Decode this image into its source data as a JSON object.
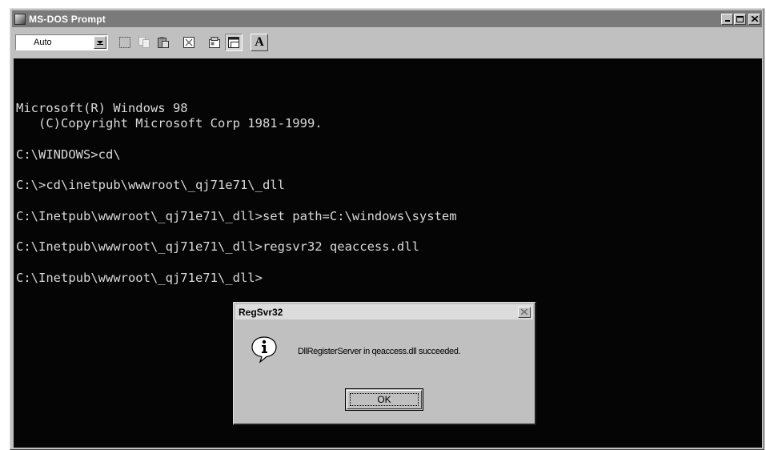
{
  "window": {
    "title": "MS-DOS Prompt",
    "icon": "msdos-app-icon",
    "controls": [
      "minimize-icon",
      "maximize-icon",
      "close-icon"
    ]
  },
  "toolbar": {
    "font_size_value": "Auto",
    "buttons": [
      "mark-icon",
      "copy-icon",
      "paste-icon",
      "fullscreen-icon",
      "properties-icon",
      "background-icon",
      "font-icon"
    ],
    "font_button_label": "A"
  },
  "console": {
    "lines": [
      "Microsoft(R) Windows 98",
      "   (C)Copyright Microsoft Corp 1981-1999.",
      "C:\\WINDOWS>cd\\",
      "C:\\>cd\\inetpub\\wwwroot\\_qj71e71\\_dll",
      "C:\\Inetpub\\wwwroot\\_qj71e71\\_dll>set path=C:\\windows\\system",
      "C:\\Inetpub\\wwwroot\\_qj71e71\\_dll>regsvr32 qeaccess.dll",
      "C:\\Inetpub\\wwwroot\\_qj71e71\\_dll>"
    ]
  },
  "dialog": {
    "title": "RegSvr32",
    "message": "DllRegisterServer in qeaccess.dll succeeded.",
    "ok_label": "OK",
    "icon": "info-icon"
  }
}
